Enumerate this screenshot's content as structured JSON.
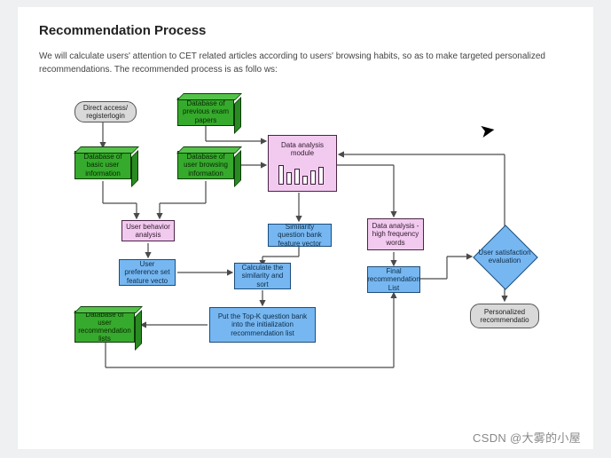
{
  "title": "Recommendation Process",
  "intro": "We will calculate users' attention to CET related articles according to users' browsing habits, so as to make targeted personalized recommendations. The recommended process is as follo ws:",
  "nodes": {
    "direct_access": "Direct access/ registerlogin",
    "db_prev_exam": "Database of previous exam papers",
    "db_basic_user": "Database of basic user information",
    "db_browsing": "Database of user browsing information",
    "data_analysis_mod": "Data analysis module",
    "user_behavior": "User behavior analysis",
    "similarity_vector": "Similarity question bank feature vector",
    "data_high_freq": "Data analysis - high frequency words",
    "user_pref_vector": "User preference set feature vecto",
    "calc_similarity": "Calculate the similarity and sort",
    "final_list": "Final recommendation List",
    "user_sat_eval": "User satisfaction evaluation",
    "db_user_rec": "Database of user recommendation lists",
    "put_topk": "Put the Top-K question bank into the initialization recommendation list",
    "personalized_rec": "Personalized recommendatio"
  },
  "watermark": "CSDN @大雾的小屋",
  "colors": {
    "green": "#36aa2c",
    "pink": "#f2caef",
    "blue": "#77b7f1",
    "grey": "#d9d9d9",
    "arrow": "#4a4a4a"
  }
}
